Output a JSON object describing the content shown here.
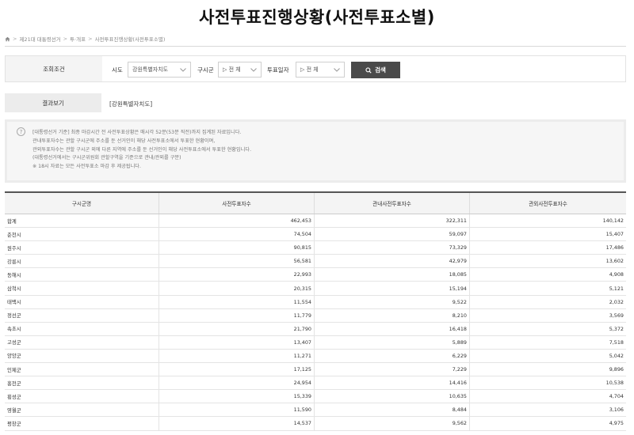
{
  "page_title": "사전투표진행상황(사전투표소별)",
  "breadcrumb": [
    "제21대 대통령선거",
    "투·개표",
    "사전투표진행상황(사전투표소별)"
  ],
  "search": {
    "header": "조회조건",
    "sido_label": "시도",
    "sido_value": "강원특별자치도",
    "gusigun_label": "구시군",
    "gusigun_value": "▷ 전 체",
    "date_label": "투표일자",
    "date_value": "▷ 전 체",
    "button_label": "검색"
  },
  "result": {
    "header": "결과보기",
    "value": "[강원특별자치도]"
  },
  "notice": [
    "[대통령선거 기준] 최종 마감시간 전 사전투표상황은 매시각 52분(53분 직전)까지 집계된 자료입니다.",
    "관내투표자수는 관할 구시군에 주소를 둔 선거인이 해당 사전투표소에서 투표한 현황이며,",
    "관외투표자수는 관할 구시군 외에 다른 지역에 주소를 둔 선거인이 해당 사전투표소에서 투표한 현황입니다.",
    "(대통령선거에서는 구시군위원회 관할구역을 기준으로 관내/관외를 구분)",
    "※ 18시 자료는 모든 사전투표소 마감 후 제공됩니다."
  ],
  "table": {
    "headers": [
      "구시군명",
      "사전투표자수",
      "관내사전투표자수",
      "관외사전투표자수"
    ],
    "rows": [
      [
        "합계",
        "462,453",
        "322,311",
        "140,142"
      ],
      [
        "춘천시",
        "74,504",
        "59,097",
        "15,407"
      ],
      [
        "원주시",
        "90,815",
        "73,329",
        "17,486"
      ],
      [
        "강릉시",
        "56,581",
        "42,979",
        "13,602"
      ],
      [
        "동해시",
        "22,993",
        "18,085",
        "4,908"
      ],
      [
        "삼척시",
        "20,315",
        "15,194",
        "5,121"
      ],
      [
        "태백시",
        "11,554",
        "9,522",
        "2,032"
      ],
      [
        "정선군",
        "11,779",
        "8,210",
        "3,569"
      ],
      [
        "속초시",
        "21,790",
        "16,418",
        "5,372"
      ],
      [
        "고성군",
        "13,407",
        "5,889",
        "7,518"
      ],
      [
        "양양군",
        "11,271",
        "6,229",
        "5,042"
      ],
      [
        "인제군",
        "17,125",
        "7,229",
        "9,896"
      ],
      [
        "홍천군",
        "24,954",
        "14,416",
        "10,538"
      ],
      [
        "횡성군",
        "15,339",
        "10,635",
        "4,704"
      ],
      [
        "영월군",
        "11,590",
        "8,484",
        "3,106"
      ],
      [
        "평창군",
        "14,537",
        "9,562",
        "4,975"
      ]
    ]
  }
}
